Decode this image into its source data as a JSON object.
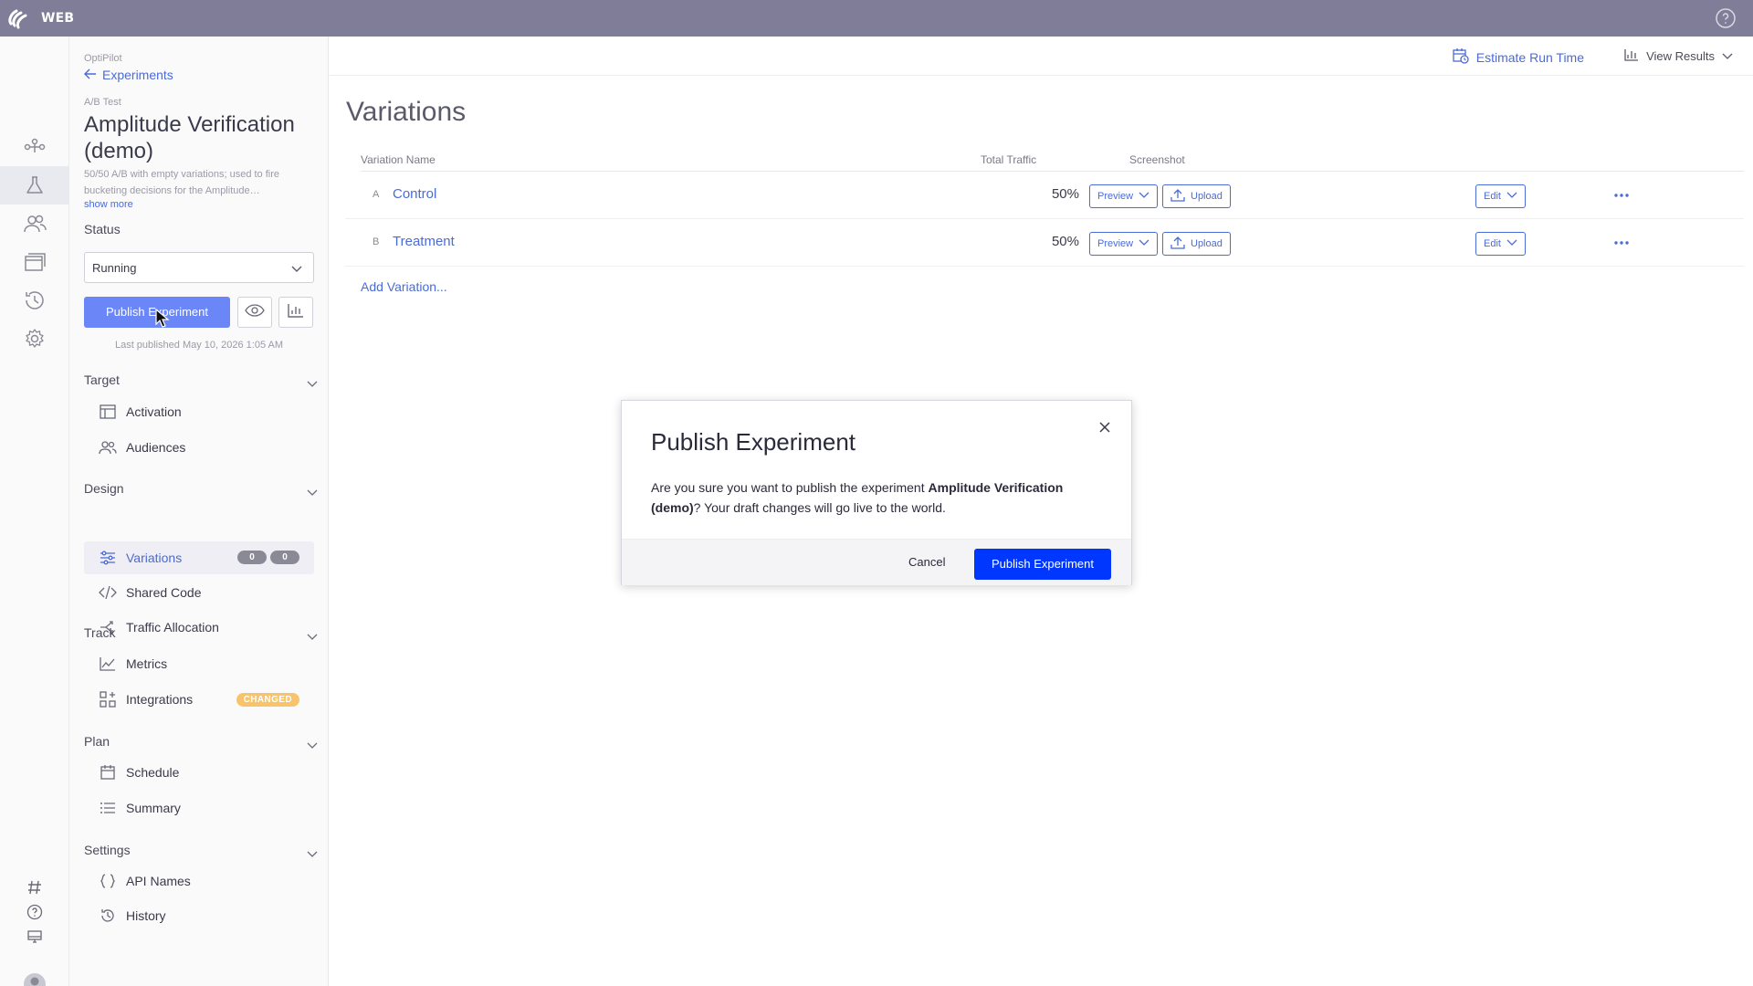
{
  "app": {
    "name": "WEB",
    "logo_icon": "optimizely-logo-icon",
    "help_icon": "help-circle-icon"
  },
  "rail": {
    "icons": [
      "flags-icon",
      "experiments-flask-icon",
      "audiences-icon",
      "pages-icon",
      "history-icon",
      "settings-gear-icon"
    ],
    "bottom_icons": [
      "hash-icon",
      "help-icon",
      "monitor-icon",
      "avatar-icon"
    ],
    "active": "experiments-flask-icon"
  },
  "sidebar": {
    "project": "OptiPilot",
    "back_label": "Experiments",
    "experiment_type": "A/B Test",
    "title": "Amplitude Verification (demo)",
    "description": "50/50 A/B with empty variations; used to fire bucketing decisions for the Amplitude…",
    "show_more": "show more",
    "status_label": "Status",
    "status_value": "Running",
    "publish_label": "Publish Experiment",
    "last_published": "Last published May 10, 2026 1:05 AM",
    "sections": {
      "target": {
        "label": "Target",
        "items": [
          "Activation",
          "Audiences"
        ]
      },
      "design": {
        "label": "Design",
        "items": [
          "Variations",
          "Shared Code",
          "Traffic Allocation"
        ],
        "variation_counts": [
          "0",
          "0"
        ]
      },
      "track": {
        "label": "Track",
        "items": [
          "Metrics",
          "Integrations"
        ],
        "integrations_badge": "CHANGED"
      },
      "plan": {
        "label": "Plan",
        "items": [
          "Schedule",
          "Summary"
        ]
      },
      "settings": {
        "label": "Settings",
        "items": [
          "API Names",
          "History"
        ]
      }
    }
  },
  "main": {
    "estimate_label": "Estimate Run Time",
    "view_results_label": "View Results",
    "page_title": "Variations",
    "columns": [
      "Variation Name",
      "Total Traffic",
      "Screenshot"
    ],
    "rows": [
      {
        "letter": "A",
        "name": "Control",
        "traffic": "50%",
        "preview": "Preview",
        "upload": "Upload",
        "edit": "Edit"
      },
      {
        "letter": "B",
        "name": "Treatment",
        "traffic": "50%",
        "preview": "Preview",
        "upload": "Upload",
        "edit": "Edit"
      }
    ],
    "add_variation": "Add Variation..."
  },
  "modal": {
    "title": "Publish Experiment",
    "body_prefix": "Are you sure you want to publish the experiment ",
    "body_bold": "Amplitude Verification (demo)",
    "body_suffix": "? Your draft changes will go live to the world.",
    "cancel": "Cancel",
    "confirm": "Publish Experiment"
  },
  "colors": {
    "topbar": "#7f7d97",
    "link": "#4a6bd8",
    "primary": "#0037ff",
    "publish_sidebar": "#6b86f7",
    "badge_changed": "#f7c36b"
  }
}
